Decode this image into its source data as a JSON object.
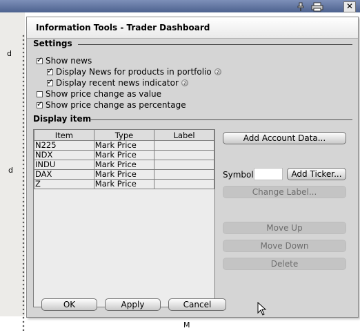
{
  "background": {
    "left_fragments": [
      "d",
      "d"
    ],
    "pin_icon": "pin-icon",
    "printer_icon": "printer-icon",
    "close_glyph": "✕",
    "footer_fragment": "M"
  },
  "dialog": {
    "title": "Information Tools - Trader Dashboard",
    "settings": {
      "title": "Settings",
      "show_news": {
        "label": "Show news",
        "checked": true
      },
      "news_portfolio": {
        "label": "Display News for products in portfolio",
        "checked": true
      },
      "news_indicator": {
        "label": "Display recent news indicator",
        "checked": true
      },
      "price_value": {
        "label": "Show price change as value",
        "checked": false
      },
      "price_percent": {
        "label": "Show price change as percentage",
        "checked": true
      }
    },
    "display_item": {
      "title": "Display item",
      "columns": [
        "Item",
        "Type",
        "Label"
      ],
      "rows": [
        {
          "item": "N225",
          "type": "Mark Price",
          "label": ""
        },
        {
          "item": "NDX",
          "type": "Mark Price",
          "label": ""
        },
        {
          "item": "INDU",
          "type": "Mark Price",
          "label": ""
        },
        {
          "item": "DAX",
          "type": "Mark Price",
          "label": ""
        },
        {
          "item": "Z",
          "type": "Mark Price",
          "label": ""
        }
      ]
    },
    "buttons": {
      "add_account_data": "Add Account Data...",
      "symbol_label": "Symbol:",
      "symbol_value": "",
      "add_ticker": "Add Ticker...",
      "change_label": "Change Label...",
      "move_up": "Move Up",
      "move_down": "Move Down",
      "delete": "Delete",
      "ok": "OK",
      "apply": "Apply",
      "cancel": "Cancel"
    }
  }
}
